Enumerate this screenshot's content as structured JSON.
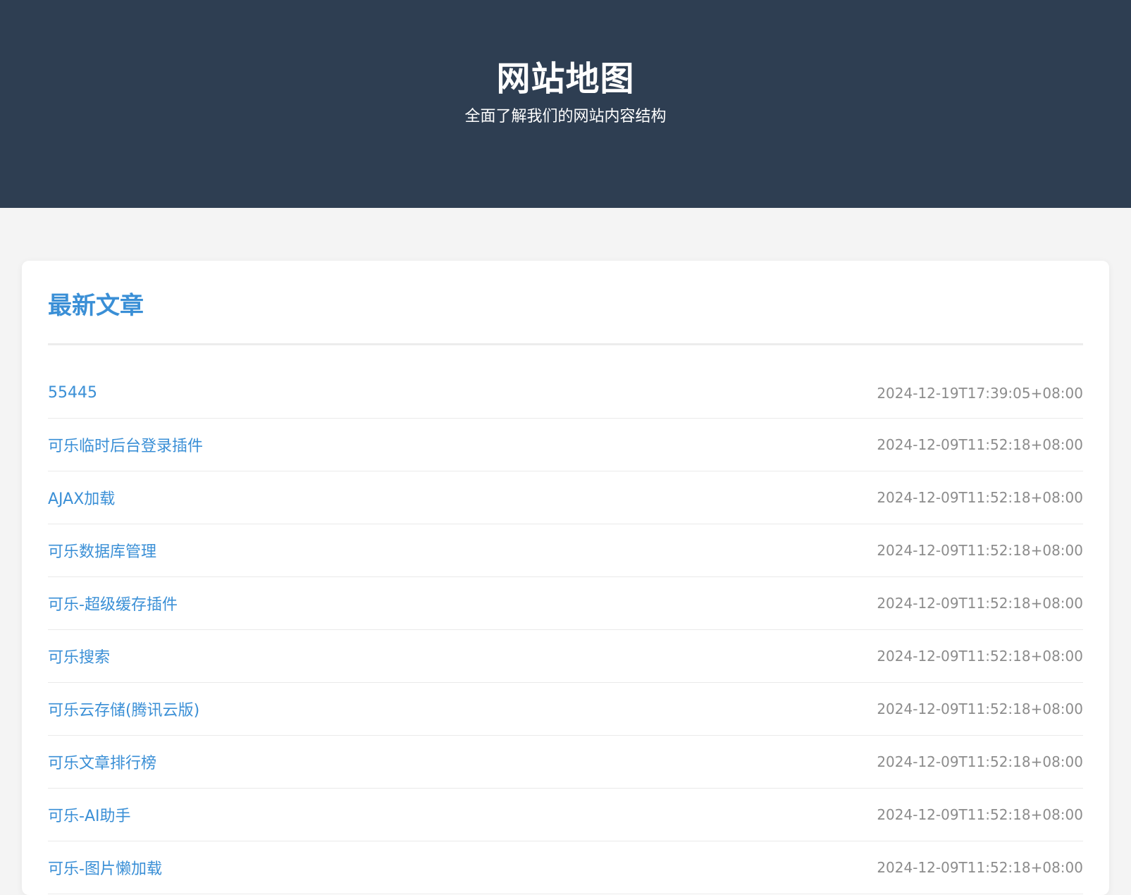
{
  "header": {
    "title": "网站地图",
    "subtitle": "全面了解我们的网站内容结构"
  },
  "section": {
    "title": "最新文章",
    "items": [
      {
        "title": "55445",
        "date": "2024-12-19T17:39:05+08:00"
      },
      {
        "title": "可乐临时后台登录插件",
        "date": "2024-12-09T11:52:18+08:00"
      },
      {
        "title": "AJAX加载",
        "date": "2024-12-09T11:52:18+08:00"
      },
      {
        "title": "可乐数据库管理",
        "date": "2024-12-09T11:52:18+08:00"
      },
      {
        "title": "可乐-超级缓存插件",
        "date": "2024-12-09T11:52:18+08:00"
      },
      {
        "title": "可乐搜索",
        "date": "2024-12-09T11:52:18+08:00"
      },
      {
        "title": "可乐云存储(腾讯云版)",
        "date": "2024-12-09T11:52:18+08:00"
      },
      {
        "title": "可乐文章排行榜",
        "date": "2024-12-09T11:52:18+08:00"
      },
      {
        "title": "可乐-AI助手",
        "date": "2024-12-09T11:52:18+08:00"
      },
      {
        "title": "可乐-图片懒加载",
        "date": "2024-12-09T11:52:18+08:00"
      }
    ]
  },
  "colors": {
    "header_bg": "#2e3e52",
    "page_bg": "#f4f4f4",
    "accent": "#3a8fd6",
    "date_text": "#8c8c8c"
  }
}
